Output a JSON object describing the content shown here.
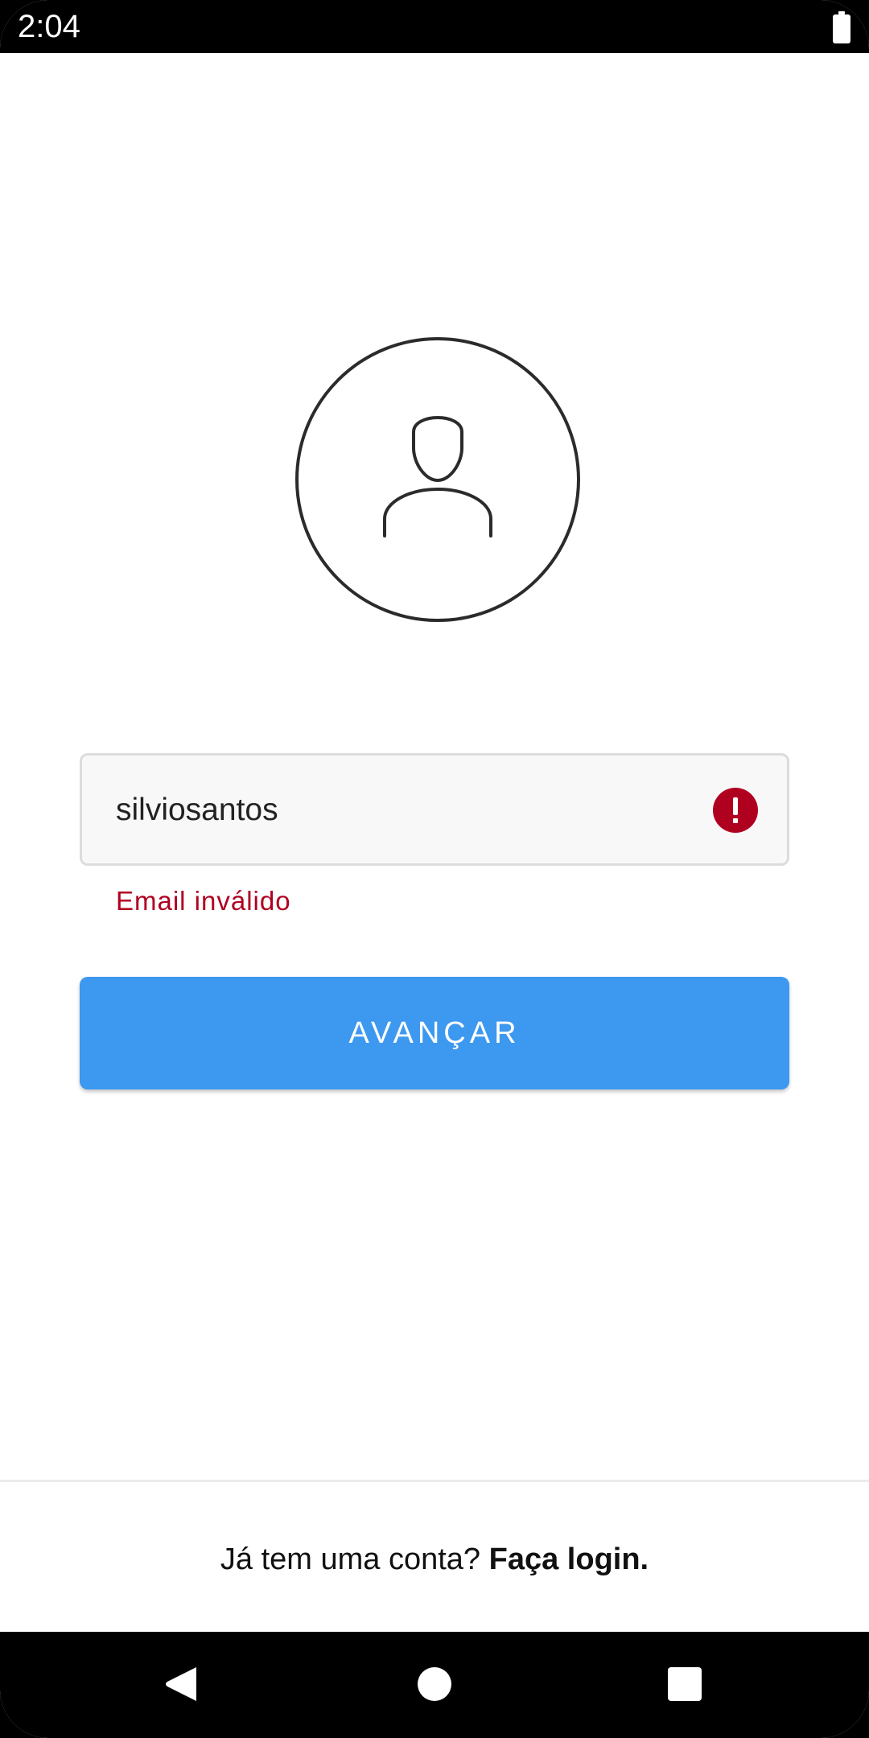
{
  "status_bar": {
    "time": "2:04",
    "battery_icon": "battery-icon"
  },
  "avatar": {
    "icon": "user-avatar-icon",
    "stroke_color": "#2b2b2b"
  },
  "email_input": {
    "value": "silviosantos",
    "error_icon": "error-icon",
    "error_color": "#b00020",
    "error_message": "Email inválido"
  },
  "next_button": {
    "label": "AVANÇAR",
    "color": "#3d98f0"
  },
  "footer": {
    "question": "Já tem uma conta?",
    "link_label": "Faça login."
  },
  "nav_bar": {
    "back_icon": "back-triangle-icon",
    "home_icon": "home-circle-icon",
    "recents_icon": "recents-square-icon"
  }
}
